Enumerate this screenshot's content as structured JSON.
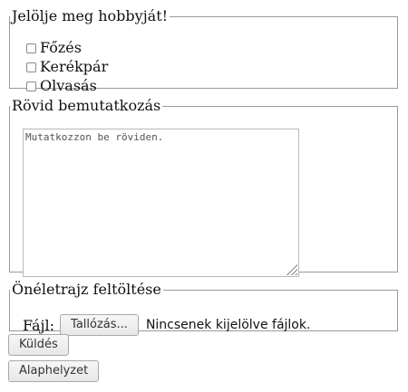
{
  "hobby": {
    "legend": "Jelölje meg hobbyját!",
    "options": [
      {
        "label": "Főzés",
        "checked": false
      },
      {
        "label": "Kerékpár",
        "checked": false
      },
      {
        "label": "Olvasás",
        "checked": false
      }
    ]
  },
  "bio": {
    "legend": "Rövid bemutatkozás",
    "placeholder": "Mutatkozzon be röviden."
  },
  "cv": {
    "legend": "Önéletrajz feltöltése",
    "file_label": "Fájl:",
    "browse_label": "Tallózás...",
    "status": "Nincsenek kijelölve fájlok."
  },
  "actions": {
    "submit_label": "Küldés",
    "reset_label": "Alaphelyzet"
  }
}
